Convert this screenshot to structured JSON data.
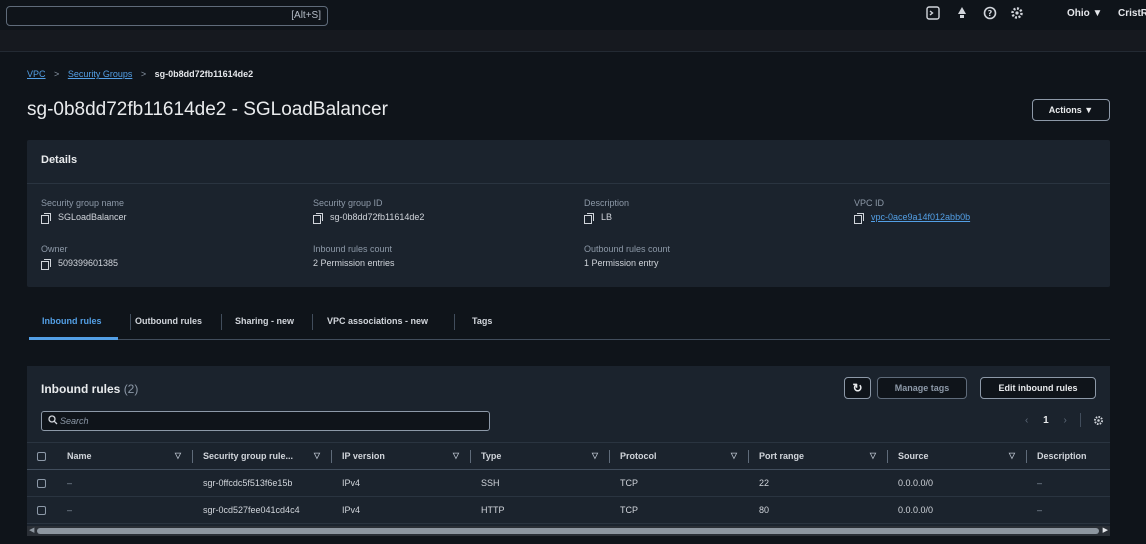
{
  "topbar": {
    "search_shortcut": "[Alt+S]",
    "icons": [
      "cloudshell-icon",
      "notifications-icon",
      "help-icon",
      "settings-icon"
    ],
    "region": "Ohio ▼",
    "user": "CristR"
  },
  "breadcrumb": {
    "items": [
      "VPC",
      "Security Groups"
    ],
    "current": "sg-0b8dd72fb11614de2"
  },
  "page": {
    "title": "sg-0b8dd72fb11614de2 - SGLoadBalancer",
    "actions_label": "Actions ▼"
  },
  "details": {
    "header": "Details",
    "fields": {
      "sg_name": {
        "label": "Security group name",
        "value": "SGLoadBalancer"
      },
      "sg_id": {
        "label": "Security group ID",
        "value": "sg-0b8dd72fb11614de2"
      },
      "description": {
        "label": "Description",
        "value": "LB"
      },
      "vpc_id": {
        "label": "VPC ID",
        "value": "vpc-0ace9a14f012abb0b"
      },
      "owner": {
        "label": "Owner",
        "value": "509399601385"
      },
      "inbound_count": {
        "label": "Inbound rules count",
        "value": "2 Permission entries"
      },
      "outbound_count": {
        "label": "Outbound rules count",
        "value": "1 Permission entry"
      }
    }
  },
  "tabs": [
    {
      "label": "Inbound rules",
      "active": true
    },
    {
      "label": "Outbound rules",
      "active": false
    },
    {
      "label": "Sharing - new",
      "active": false
    },
    {
      "label": "VPC associations - new",
      "active": false
    },
    {
      "label": "Tags",
      "active": false
    }
  ],
  "inbound": {
    "title": "Inbound rules",
    "count": "(2)",
    "refresh_icon": "↻",
    "manage_tags_label": "Manage tags",
    "edit_label": "Edit inbound rules",
    "search_placeholder": "Search",
    "pager": {
      "prev": "‹",
      "page": "1",
      "next": "›"
    },
    "columns": [
      "Name",
      "Security group rule...",
      "IP version",
      "Type",
      "Protocol",
      "Port range",
      "Source",
      "Description"
    ],
    "rows": [
      {
        "name": "–",
        "rule_id": "sgr-0ffcdc5f513f6e15b",
        "ip_version": "IPv4",
        "type": "SSH",
        "protocol": "TCP",
        "port_range": "22",
        "source": "0.0.0.0/0",
        "description": "–"
      },
      {
        "name": "–",
        "rule_id": "sgr-0cd527fee041cd4c4",
        "ip_version": "IPv4",
        "type": "HTTP",
        "protocol": "TCP",
        "port_range": "80",
        "source": "0.0.0.0/0",
        "description": "–"
      }
    ]
  }
}
